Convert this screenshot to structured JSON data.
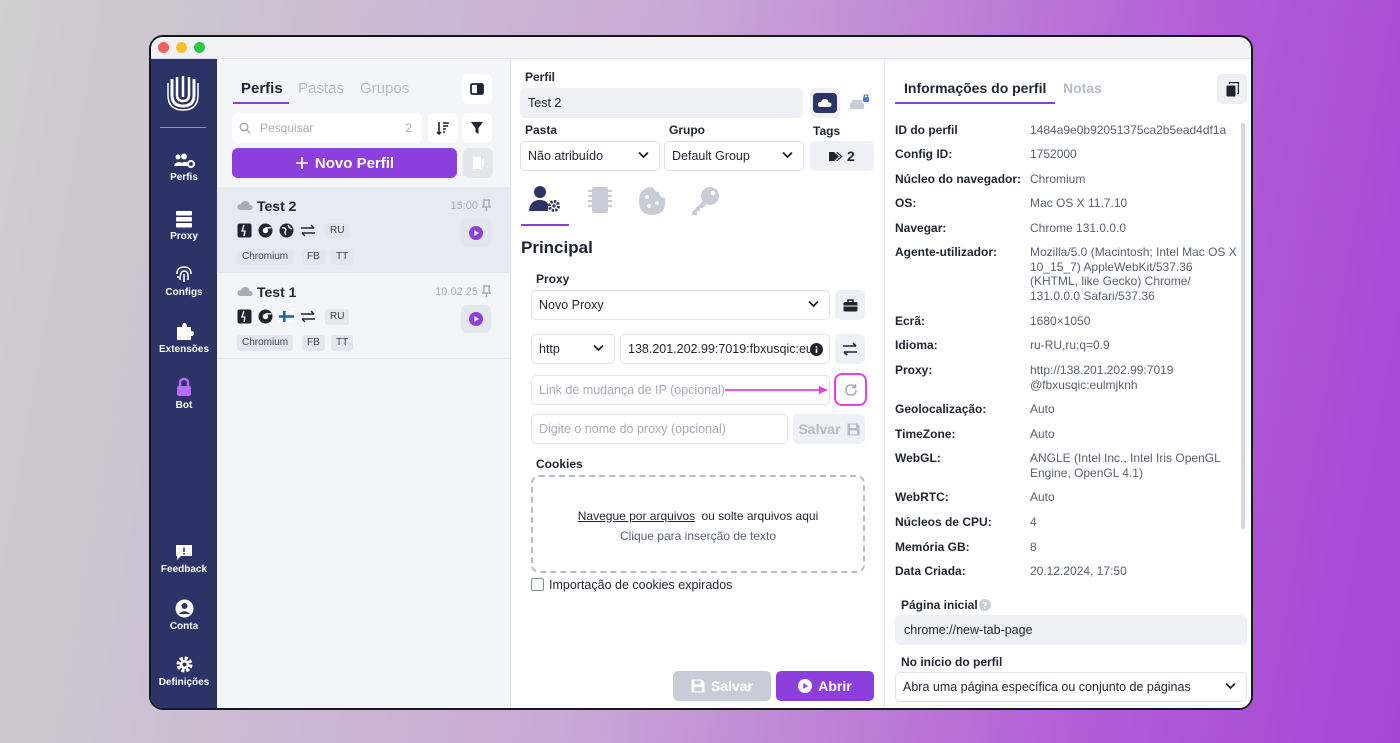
{
  "nav": {
    "items": [
      {
        "label": "Perfis",
        "icon": "users-gear-icon"
      },
      {
        "label": "Proxy",
        "icon": "server-icon"
      },
      {
        "label": "Configs",
        "icon": "fingerprint-icon"
      },
      {
        "label": "Extensões",
        "icon": "puzzle-icon"
      },
      {
        "label": "Bot",
        "icon": "lock-icon"
      },
      {
        "label": "Feedback",
        "icon": "feedback-icon"
      },
      {
        "label": "Conta",
        "icon": "account-icon"
      },
      {
        "label": "Definições",
        "icon": "gear-icon"
      }
    ]
  },
  "profiles": {
    "tabs": [
      "Perfis",
      "Pastas",
      "Grupos"
    ],
    "search_placeholder": "Pesquisar",
    "count": "2",
    "new_label": "Novo Perfil",
    "rows": [
      {
        "name": "Test 2",
        "time": "15:00",
        "region": "RU",
        "tags": [
          "Chromium",
          "FB",
          "TT"
        ]
      },
      {
        "name": "Test 1",
        "time": "10.02.25",
        "region": "RU",
        "tags": [
          "Chromium",
          "FB",
          "TT"
        ]
      }
    ]
  },
  "editor": {
    "perfil_label": "Perfil",
    "perfil_value": "Test 2",
    "pasta_label": "Pasta",
    "pasta_value": "Não atribuído",
    "grupo_label": "Grupo",
    "grupo_value": "Default Group",
    "tags_label": "Tags",
    "tags_count": "2",
    "section_title": "Principal",
    "proxy_label": "Proxy",
    "proxy_value": "Novo Proxy",
    "protocol": "http",
    "proxy_address": "138.201.202.99:7019:fbxusqic:eu",
    "ip_link_placeholder": "Link de mudança de IP (opcional)",
    "proxy_name_placeholder": "Digite o nome do proxy (opcional)",
    "save_proxy_label": "Salvar",
    "cookies_label": "Cookies",
    "browse_link": "Navegue por arquivos",
    "drop_text": "ou solte arquivos aqui",
    "paste_text": "Clique para inserção de texto",
    "expired_label": "Importação de cookies expirados",
    "save_label": "Salvar",
    "open_label": "Abrir",
    "accent": "#8c3fdc",
    "highlight": "#e83ee6"
  },
  "info": {
    "tabs": [
      "Informações do perfil",
      "Notas"
    ],
    "rows": [
      {
        "k": "ID do perfil",
        "v": "1484a9e0b92051375ca2b5ead4df1a"
      },
      {
        "k": "Config ID:",
        "v": "1752000"
      },
      {
        "k": "Núcleo do navegador:",
        "v": "Chromium"
      },
      {
        "k": "OS:",
        "v": "Mac OS X 11.7.10"
      },
      {
        "k": "Navegar:",
        "v": "Chrome 131.0.0.0"
      },
      {
        "k": "Agente-utilizador:",
        "v": "Mozilla/5.0 (Macintosh; Intel Mac OS X 10_15_7) AppleWebKit/537.36 (KHTML, like Gecko) Chrome/ 131.0.0.0 Safari/537.36"
      },
      {
        "k": "Ecrã:",
        "v": "1680×1050"
      },
      {
        "k": "Idioma:",
        "v": "ru-RU,ru;q=0.9"
      },
      {
        "k": "Proxy:",
        "v": "http://138.201.202.99:7019 @fbxusqic:eulmjknh"
      },
      {
        "k": "Geolocalização:",
        "v": "Auto"
      },
      {
        "k": "TimeZone:",
        "v": "Auto"
      },
      {
        "k": "WebGL:",
        "v": "ANGLE (Intel Inc., Intel Iris OpenGL Engine, OpenGL 4.1)"
      },
      {
        "k": "WebRTC:",
        "v": "Auto"
      },
      {
        "k": "Núcleos de CPU:",
        "v": "4"
      },
      {
        "k": "Memória GB:",
        "v": "8"
      },
      {
        "k": "Data Criada:",
        "v": "20.12.2024, 17:50"
      }
    ],
    "start_page_label": "Página inicial",
    "start_page_value": "chrome://new-tab-page",
    "on_start_label": "No início do perfil",
    "on_start_value": "Abra uma página específica ou conjunto de páginas"
  }
}
